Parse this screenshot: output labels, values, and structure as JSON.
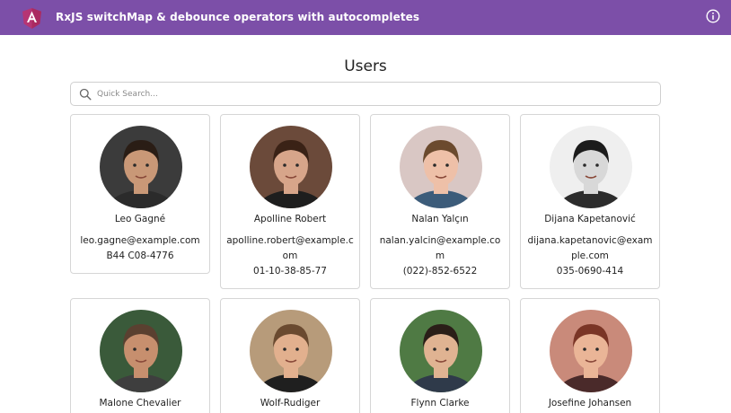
{
  "header": {
    "title": "RxJS switchMap & debounce operators with autocompletes",
    "logo_icon": "angular-logo-icon",
    "info_icon": "info-icon",
    "bar_color": "#7c4fa8"
  },
  "page": {
    "title": "Users"
  },
  "search": {
    "placeholder": "Quick Search...",
    "value": ""
  },
  "users": [
    {
      "name": "Leo Gagné",
      "email": "leo.gagne@example.com",
      "phone": "B44 C08-4776",
      "skin": "#c99877",
      "hair": "#2a1d15",
      "bg": "#3b3b3b",
      "shirt": "#2b2b2b"
    },
    {
      "name": "Apolline Robert",
      "email": "apolline.robert@example.com",
      "phone": "01-10-38-85-77",
      "skin": "#d7a58a",
      "hair": "#3a2216",
      "bg": "#6b4a3a",
      "shirt": "#1e1e1e"
    },
    {
      "name": "Nalan Yalçın",
      "email": "nalan.yalcin@example.com",
      "phone": "(022)-852-6522",
      "skin": "#eec0a8",
      "hair": "#6b4a2e",
      "bg": "#d9c7c4",
      "shirt": "#3c5c7a"
    },
    {
      "name": "Dijana Kapetanović",
      "email": "dijana.kapetanovic@example.com",
      "phone": "035-0690-414",
      "skin": "#d8d8d8",
      "hair": "#1c1c1c",
      "bg": "#efefef",
      "shirt": "#2c2c2c"
    },
    {
      "name": "Malone Chevalier",
      "email": "",
      "phone": "",
      "skin": "#c78f6e",
      "hair": "#5a4030",
      "bg": "#3a5a3a",
      "shirt": "#3e3e3e"
    },
    {
      "name": "Wolf-Rudiger",
      "email": "",
      "phone": "",
      "skin": "#e2b08e",
      "hair": "#6a4a30",
      "bg": "#b79b7a",
      "shirt": "#1f1f1f"
    },
    {
      "name": "Flynn Clarke",
      "email": "",
      "phone": "",
      "skin": "#e0b392",
      "hair": "#2a1e18",
      "bg": "#4f7a44",
      "shirt": "#2f3a4a"
    },
    {
      "name": "Josefine Johansen",
      "email": "",
      "phone": "",
      "skin": "#eab597",
      "hair": "#7a3526",
      "bg": "#c98a7a",
      "shirt": "#4a2a2a"
    }
  ]
}
